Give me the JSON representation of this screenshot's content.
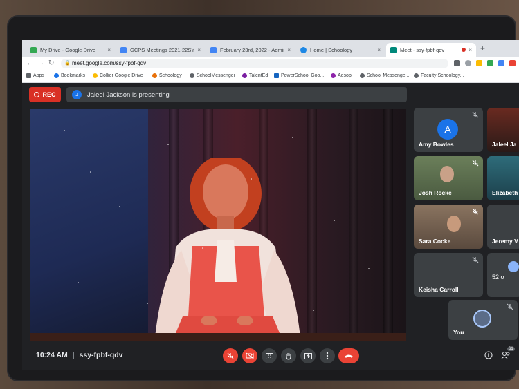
{
  "browser": {
    "tabs": [
      {
        "title": "My Drive - Google Drive",
        "favicon_color": "#34a853",
        "close": "×"
      },
      {
        "title": "GCPS Meetings 2021-22SY - G",
        "favicon_color": "#4285f4",
        "close": "×"
      },
      {
        "title": "February 23rd, 2022 - Admin",
        "favicon_color": "#4285f4",
        "close": "×"
      },
      {
        "title": "Home | Schoology",
        "favicon_color": "#1e88e5",
        "close": "×"
      },
      {
        "title": "Meet - ssy-fpbf-qdv",
        "favicon_color": "#00897b",
        "close": "×"
      }
    ],
    "new_tab": "+",
    "url": "meet.google.com/ssy-fpbf-qdv",
    "bookmarks": [
      {
        "label": "Apps",
        "color": "#5f6368"
      },
      {
        "label": "Bookmarks",
        "color": "#1a73e8"
      },
      {
        "label": "Collier Google Drive",
        "color": "#fbbc04"
      },
      {
        "label": "Schoology",
        "color": "#e8710a"
      },
      {
        "label": "SchoolMessenger",
        "color": "#5f6368"
      },
      {
        "label": "TalentEd",
        "color": "#7b1fa2"
      },
      {
        "label": "PowerSchool Goo...",
        "color": "#1565c0"
      },
      {
        "label": "Aesop",
        "color": "#8e24aa"
      },
      {
        "label": "School Messenge...",
        "color": "#5f6368"
      },
      {
        "label": "Faculty Schoology...",
        "color": "#5f6368"
      }
    ]
  },
  "meet": {
    "rec_label": "REC",
    "presenter_initial": "J",
    "presenting_text": "Jaleel Jackson is presenting",
    "participants": [
      {
        "name": "Amy Bowles",
        "initial": "A"
      },
      {
        "name": "Jaleel Ja"
      },
      {
        "name": "Josh Rocke"
      },
      {
        "name": "Elizabeth"
      },
      {
        "name": "Sara Cocke"
      },
      {
        "name": "Jeremy V"
      },
      {
        "name": "Keisha Carroll"
      },
      {
        "name": "52 o"
      },
      {
        "name": "You"
      }
    ],
    "time": "10:24 AM",
    "separator": "|",
    "meeting_code": "ssy-fpbf-qdv",
    "people_count": "61",
    "colors": {
      "rec_red": "#d93025",
      "end_call_red": "#ea4335",
      "meet_bg": "#202124",
      "tile_bg": "#3c4043",
      "avatar_blue": "#1a73e8"
    }
  }
}
